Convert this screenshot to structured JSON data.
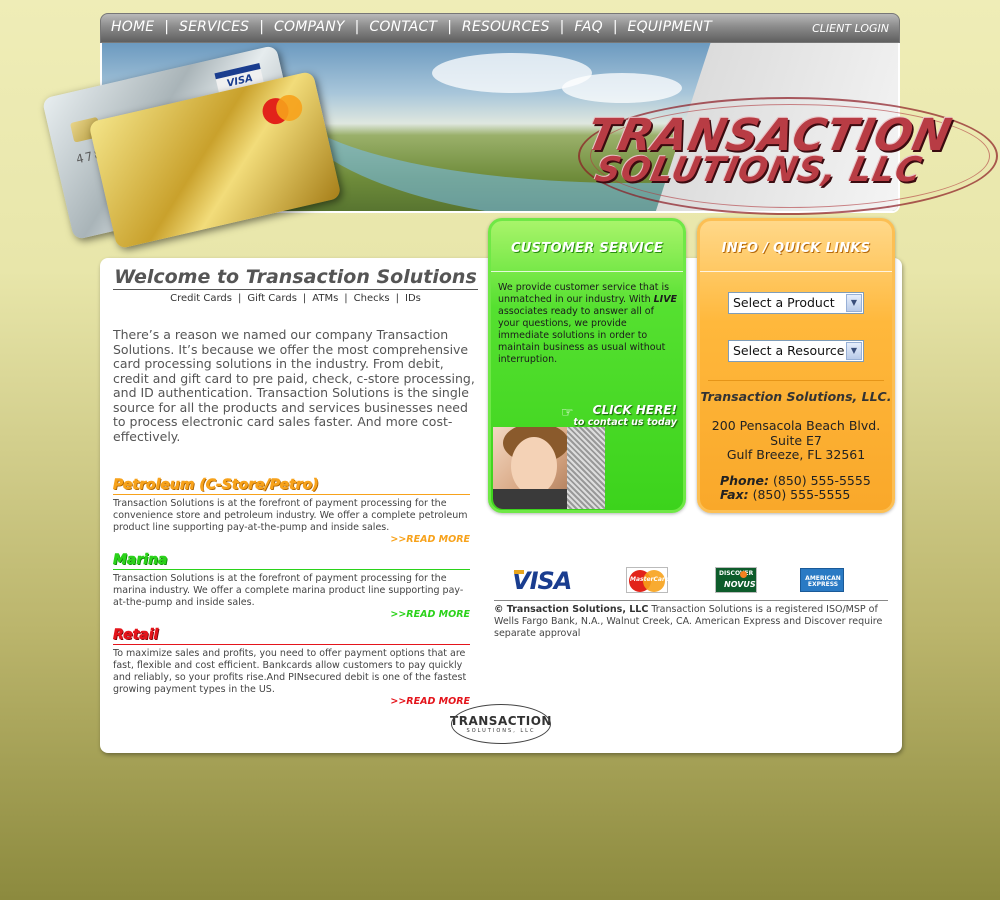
{
  "nav": {
    "items": [
      {
        "label": "HOME"
      },
      {
        "label": "SERVICES"
      },
      {
        "label": "COMPANY"
      },
      {
        "label": "CONTACT"
      },
      {
        "label": "RESOURCES"
      },
      {
        "label": "FAQ"
      },
      {
        "label": "EQUIPMENT"
      }
    ],
    "separator": "|",
    "client_login": "CLIENT LOGIN"
  },
  "banner": {
    "logo_line1": "TRANSACTION",
    "logo_line2": "SOLUTIONS, LLC",
    "card_visa": "VISA",
    "card_number": "4787"
  },
  "welcome": {
    "title": "Welcome to Transaction Solutions",
    "sub_links": [
      "Credit Cards",
      "Gift Cards",
      "ATMs",
      "Checks",
      "IDs"
    ],
    "sub_sep": "|",
    "intro": "There’s a reason we named our company Transaction Solutions. It’s because we offer the most comprehensive card processing solutions in the industry. From debit, credit and gift card to pre paid, check, c-store processing, and ID authentication. Transaction Solutions is the single source for all the products and services businesses need to process electronic card sales faster. And more cost-effectively."
  },
  "sections": [
    {
      "heading": "Petroleum (C-Store/Petro)",
      "text": "Transaction Solutions is at the forefront of payment processing for the convenience store and petroleum industry. We offer a complete petroleum product line supporting pay-at-the-pump and inside sales.",
      "read_more": ">>READ MORE",
      "color": "#f7a21b"
    },
    {
      "heading": "Marina",
      "text": "Transaction Solutions is at the forefront of payment processing for the marina industry. We offer a complete marina product line supporting pay-at-the-pump and inside sales.",
      "read_more": ">>READ MORE",
      "color": "#2bd21a"
    },
    {
      "heading": "Retail",
      "text": "To maximize sales and profits, you need to offer payment options that are fast, flexible and cost efficient. Bankcards allow customers to pay quickly and reliably, so your profits rise.And PINsecured debit is one of the fastest growing payment types in the US.",
      "read_more": ">>READ MORE",
      "color": "#e4141b"
    }
  ],
  "footer_logo": {
    "line1": "TRANSACTION",
    "line2": "SOLUTIONS, LLC"
  },
  "customer_service": {
    "header": "CUSTOMER SERVICE",
    "text_before": "We provide customer service that is unmatched in our industry. With ",
    "text_emph": "LIVE",
    "text_after": " associates ready to answer all of your questions, we provide immediate solutions in order to maintain business as usual without interruption.",
    "click_here": "CLICK HERE!",
    "contact_today": "to contact us today",
    "hand_icon": "☞"
  },
  "info": {
    "header": "INFO / QUICK LINKS",
    "product_select": "Select a Product",
    "resource_select": "Select a Resource",
    "select_arrow": "▼",
    "company_name": "Transaction Solutions, LLC.",
    "address_line1": "200 Pensacola Beach Blvd.",
    "address_line2": "Suite E7",
    "address_line3": "Gulf Breeze, FL 32561",
    "phone_label": "Phone:",
    "phone": "(850) 555-5555",
    "fax_label": "Fax:",
    "fax": "(850) 555-5555"
  },
  "payment_logos": {
    "visa": "VISA",
    "mastercard": "MasterCard",
    "discover": "DISCOVER",
    "novus": "NOVUS",
    "amex_line1": "AMERICAN",
    "amex_line2": "EXPRESS"
  },
  "legal": {
    "bold": "© Transaction Solutions, LLC",
    "text": " Transaction Solutions is a registered ISO/MSP of Wells Fargo Bank, N.A., Walnut Creek, CA. American Express and Discover require separate approval"
  }
}
